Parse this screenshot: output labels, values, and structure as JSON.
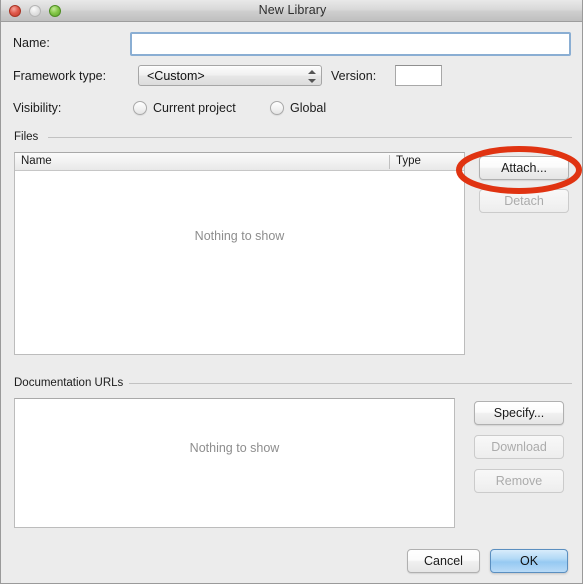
{
  "window": {
    "title": "New Library",
    "controls": {
      "close": "close-button",
      "minimize": "minimize-button",
      "zoom": "zoom-button"
    }
  },
  "form": {
    "name": {
      "label": "Name:",
      "value": "",
      "placeholder": ""
    },
    "framework_type": {
      "label": "Framework type:",
      "value": "<Custom>"
    },
    "version": {
      "label": "Version:",
      "value": "",
      "placeholder": ""
    },
    "visibility": {
      "label": "Visibility:",
      "options": [
        {
          "label": "Current project",
          "selected": false
        },
        {
          "label": "Global",
          "selected": false
        }
      ]
    }
  },
  "files_group": {
    "title": "Files",
    "columns": [
      "Name",
      "Type"
    ],
    "rows": [],
    "empty_text": "Nothing to show",
    "buttons": [
      {
        "label": "Attach...",
        "enabled": true
      },
      {
        "label": "Detach",
        "enabled": false
      }
    ]
  },
  "documentation_group": {
    "title": "Documentation URLs",
    "rows": [],
    "empty_text": "Nothing to show",
    "buttons": [
      {
        "label": "Specify...",
        "enabled": true
      },
      {
        "label": "Download",
        "enabled": false
      },
      {
        "label": "Remove",
        "enabled": false
      }
    ]
  },
  "footer": {
    "cancel_label": "Cancel",
    "ok_label": "OK"
  },
  "annotation": {
    "shape": "ellipse",
    "target": "Attach...",
    "color": "#e03311"
  },
  "colors": {
    "window_background": "#ececec",
    "focus_border": "#8aaed3",
    "default_button": "#96c9f2",
    "annotation_red": "#e03311",
    "muted_text": "#8d8d8d"
  }
}
